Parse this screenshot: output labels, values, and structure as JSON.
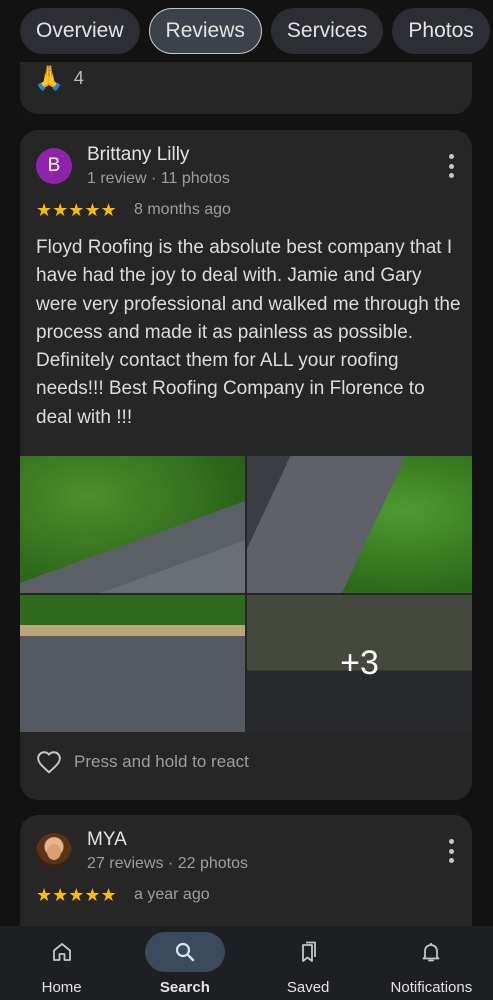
{
  "tabs": [
    {
      "label": "Overview"
    },
    {
      "label": "Reviews"
    },
    {
      "label": "Services"
    },
    {
      "label": "Photos"
    }
  ],
  "previous_review": {
    "reaction_emoji": "🙏",
    "reaction_count": "4"
  },
  "reviews": [
    {
      "avatar_letter": "B",
      "name": "Brittany Lilly",
      "meta": "1 review · 11 photos",
      "stars": "★★★★★",
      "rating": 5,
      "date": "8 months ago",
      "text": "Floyd Roofing is the absolute best company that I have had the joy to deal with. Jamie and Gary were very professional and walked me through the process and made it as painless as possible. Definitely contact them for ALL your roofing needs!!! Best Roofing Company in Florence to deal with !!!",
      "more_photos": "+3",
      "react_prompt": "Press and hold to react"
    },
    {
      "name": "MYA",
      "meta": "27 reviews · 22 photos",
      "stars": "★★★★★",
      "rating": 5,
      "date": "a year ago"
    }
  ],
  "nav": [
    {
      "label": "Home",
      "icon": "home-icon"
    },
    {
      "label": "Search",
      "icon": "search-icon"
    },
    {
      "label": "Saved",
      "icon": "bookmarks-icon"
    },
    {
      "label": "Notifications",
      "icon": "bell-icon"
    }
  ],
  "colors": {
    "background": "#121212",
    "card": "#262626",
    "star": "#fbbc04",
    "avatar_b": "#8e24aa",
    "nav_active_pill": "#3d4a5c"
  }
}
